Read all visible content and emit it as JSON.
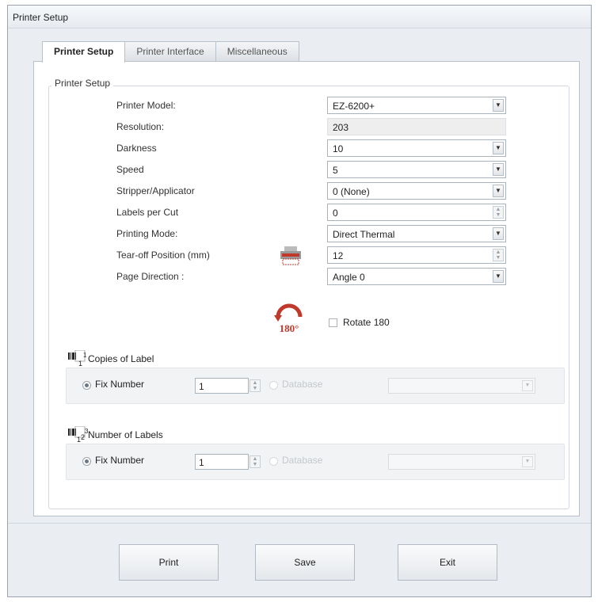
{
  "window": {
    "title": "Printer Setup"
  },
  "tabs": [
    {
      "label": "Printer Setup",
      "active": true
    },
    {
      "label": "Printer Interface",
      "active": false
    },
    {
      "label": "Miscellaneous",
      "active": false
    }
  ],
  "group": {
    "title": "Printer Setup",
    "rows": [
      {
        "label": "Printer Model:",
        "value": "EZ-6200+",
        "control": "dropdown"
      },
      {
        "label": "Resolution:",
        "value": "203",
        "control": "readonly"
      },
      {
        "label": "Darkness",
        "value": "10",
        "control": "dropdown"
      },
      {
        "label": "Speed",
        "value": "5",
        "control": "dropdown"
      },
      {
        "label": "Stripper/Applicator",
        "value": "0 (None)",
        "control": "dropdown"
      },
      {
        "label": "Labels per Cut",
        "value": "0",
        "control": "spinner"
      },
      {
        "label": "Printing Mode:",
        "value": "Direct Thermal",
        "control": "dropdown"
      },
      {
        "label": "Tear-off Position  (mm)",
        "value": "12",
        "control": "spinner"
      },
      {
        "label": "Page Direction :",
        "value": "Angle 0",
        "control": "dropdown"
      }
    ],
    "rotate": {
      "label": "Rotate 180",
      "checked": false,
      "icon_text": "180°"
    }
  },
  "copies": {
    "title_sup": "1",
    "title_sub": "1",
    "title": "Copies of Label",
    "fix_label": "Fix Number",
    "fix_value": "1",
    "db_label": "Database",
    "fix_checked": true
  },
  "number": {
    "title_sub": "1",
    "title_sup": "3",
    "title_mid": "2",
    "title": "Number of Labels",
    "fix_label": "Fix Number",
    "fix_value": "1",
    "db_label": "Database",
    "fix_checked": true
  },
  "buttons": {
    "print": "Print",
    "save": "Save",
    "exit": "Exit"
  },
  "colors": {
    "accent_red": "#c0392b",
    "window_bg": "#eaedf1"
  }
}
